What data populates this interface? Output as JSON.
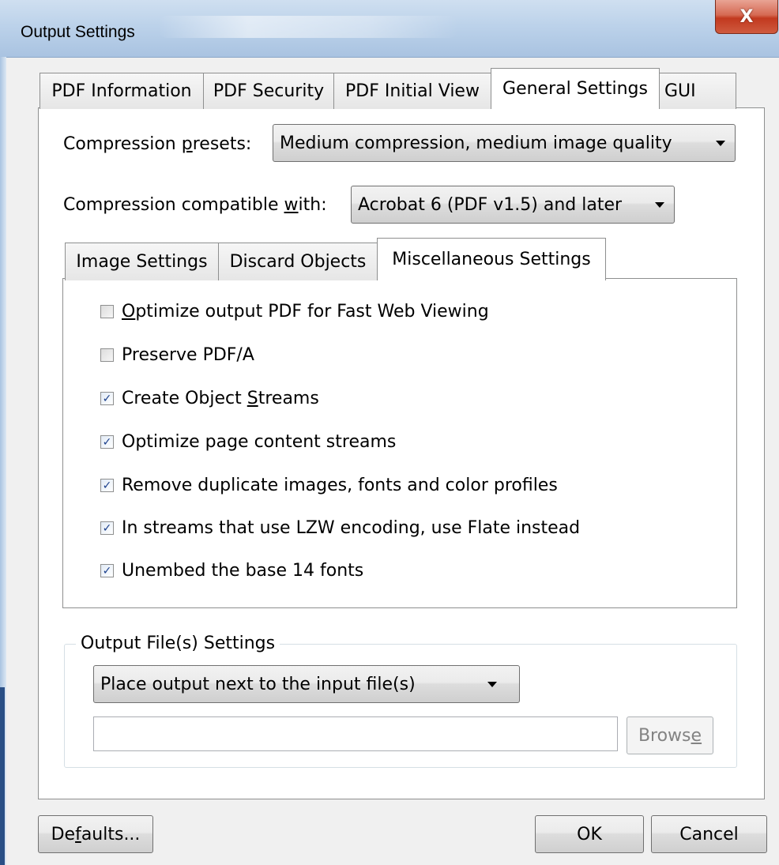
{
  "window": {
    "title": "Output Settings",
    "close_glyph": "X"
  },
  "tabs": [
    {
      "label": "PDF Information"
    },
    {
      "label": "PDF Security"
    },
    {
      "label": "PDF Initial View"
    },
    {
      "label": "General Settings"
    },
    {
      "label": "GUI"
    }
  ],
  "general": {
    "presets_label_pre": "Compression ",
    "presets_label_u": "p",
    "presets_label_post": "resets:",
    "presets_value": "Medium compression, medium image quality",
    "compat_label_pre": "Compression compatible ",
    "compat_label_u": "w",
    "compat_label_post": "ith:",
    "compat_value": "Acrobat 6 (PDF v1.5) and later"
  },
  "inner_tabs": [
    {
      "label": "Image Settings"
    },
    {
      "label": "Discard Objects"
    },
    {
      "label": "Miscellaneous Settings"
    }
  ],
  "misc": {
    "options": [
      {
        "pre": "",
        "u": "O",
        "post": "ptimize output PDF for Fast Web Viewing",
        "checked": false
      },
      {
        "pre": "Preserve PDF/A",
        "u": "",
        "post": "",
        "checked": false
      },
      {
        "pre": "Create Object ",
        "u": "S",
        "post": "treams",
        "checked": true
      },
      {
        "pre": "Optimize page content streams",
        "u": "",
        "post": "",
        "checked": true
      },
      {
        "pre": "Remove duplicate images, fonts and color profiles",
        "u": "",
        "post": "",
        "checked": true
      },
      {
        "pre": "In streams that use LZW encoding, use Flate instead",
        "u": "",
        "post": "",
        "checked": true
      },
      {
        "pre": "Unembed the base 14 fonts",
        "u": "",
        "post": "",
        "checked": true
      }
    ]
  },
  "output": {
    "group_label": "Output File(s) Settings",
    "placement_value": "Place output next to the input file(s)",
    "path_value": "",
    "browse_pre": "Brows",
    "browse_u": "e"
  },
  "footer": {
    "defaults_pre": "De",
    "defaults_u": "f",
    "defaults_post": "aults...",
    "ok_label": "OK",
    "cancel_label": "Cancel"
  },
  "colors": {
    "titlebar": "#bcd2ea",
    "close_button": "#c2391f",
    "checkmark": "#1b3f8c"
  }
}
